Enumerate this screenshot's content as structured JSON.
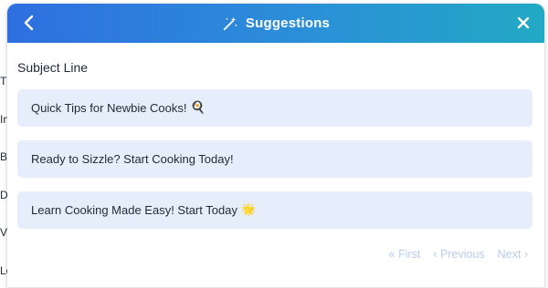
{
  "background": {
    "letters": [
      "T",
      "In",
      "B",
      "D",
      "V",
      "Lo"
    ]
  },
  "header": {
    "title": "Suggestions",
    "back_icon": "chevron-left-icon",
    "title_icon": "magic-wand-icon",
    "close_icon": "close-icon",
    "gradient": [
      "#2f6fe0",
      "#22a9c4"
    ]
  },
  "section_label": "Subject Line",
  "suggestions": [
    {
      "text": "Quick Tips for Newbie Cooks!",
      "emoji": "🍳"
    },
    {
      "text": "Ready to Sizzle? Start Cooking Today!",
      "emoji": ""
    },
    {
      "text": "Learn Cooking Made Easy! Start Today",
      "emoji": "🌟"
    }
  ],
  "pager": {
    "first": "« First",
    "previous": "‹ Previous",
    "next": "Next ›"
  }
}
